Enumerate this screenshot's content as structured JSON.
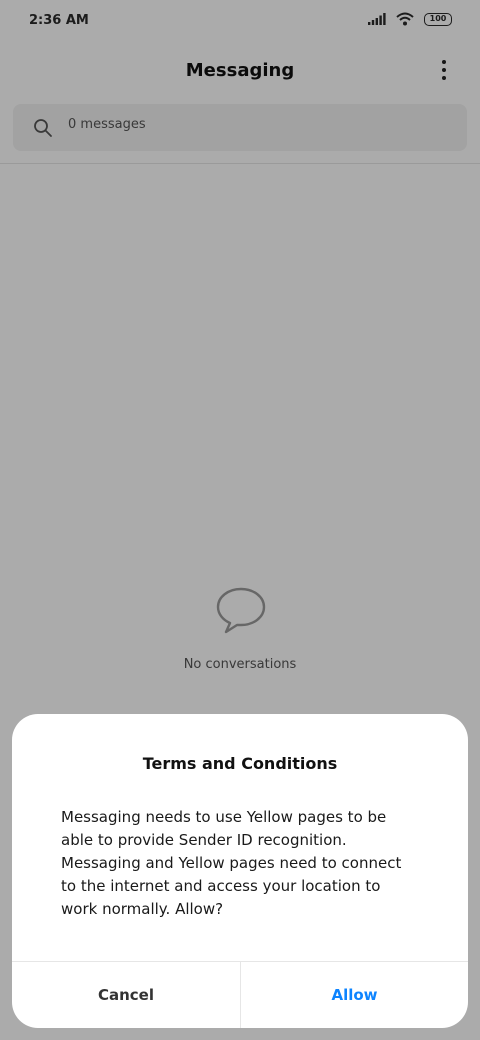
{
  "status_bar": {
    "time": "2:36 AM",
    "battery": "100"
  },
  "header": {
    "title": "Messaging",
    "more_icon": "more-vert-icon"
  },
  "search": {
    "placeholder": "0 messages",
    "icon": "search-icon"
  },
  "empty_state": {
    "icon": "chat-bubble-icon",
    "text": "No conversations"
  },
  "dialog": {
    "title": "Terms and Conditions",
    "message": "Messaging needs to use Yellow pages to be able to provide Sender ID recognition. Messaging and Yellow pages need to connect to the internet and access your location to work normally. Allow?",
    "cancel_label": "Cancel",
    "allow_label": "Allow"
  },
  "colors": {
    "accent": "#0d84ff",
    "overlay": "rgba(0,0,0,0.33)"
  }
}
